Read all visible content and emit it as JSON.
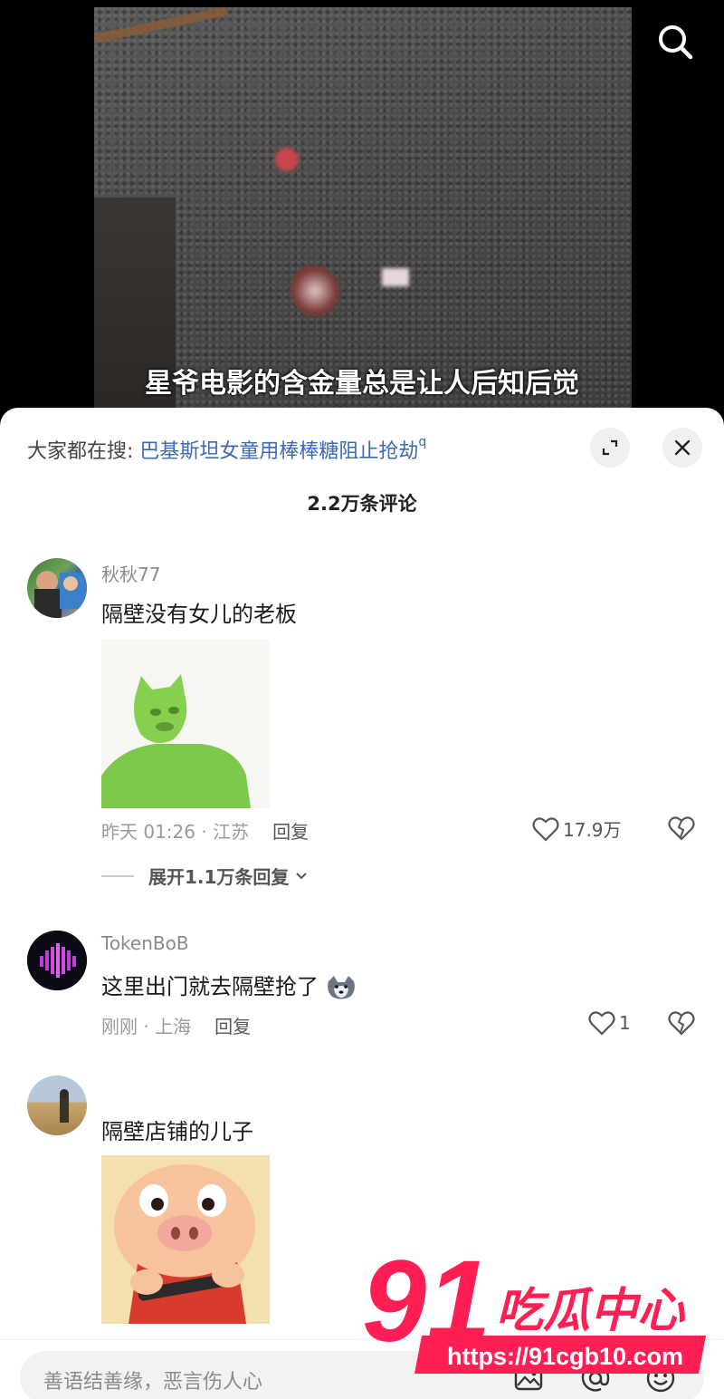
{
  "video": {
    "subtitle": "星爷电影的含金量总是让人后知后觉"
  },
  "panel": {
    "hot_search_label": "大家都在搜: ",
    "hot_search_query": "巴基斯坦女童用棒棒糖阻止抢劫",
    "comment_count": "2.2万条评论"
  },
  "comments": [
    {
      "username": "秋秋77",
      "text": "隔壁没有女儿的老板",
      "meta": "昨天 01:26 · 江苏",
      "reply_label": "回复",
      "likes": "17.9万",
      "expand_label": "展开1.1万条回复"
    },
    {
      "username": "TokenBoB",
      "text": "这里出门就去隔壁抢了",
      "meta": "刚刚 · 上海",
      "reply_label": "回复",
      "likes": "1"
    },
    {
      "username": "",
      "text": "隔壁店铺的儿子"
    }
  ],
  "input": {
    "placeholder": "善语结善缘，恶言伤人心"
  },
  "watermark": {
    "big_number": "91",
    "brand": "吃瓜中心",
    "url": "https://91cgb10.com"
  },
  "colors": {
    "link": "#3a6bb3",
    "watermark_red": "#ff1f55"
  }
}
